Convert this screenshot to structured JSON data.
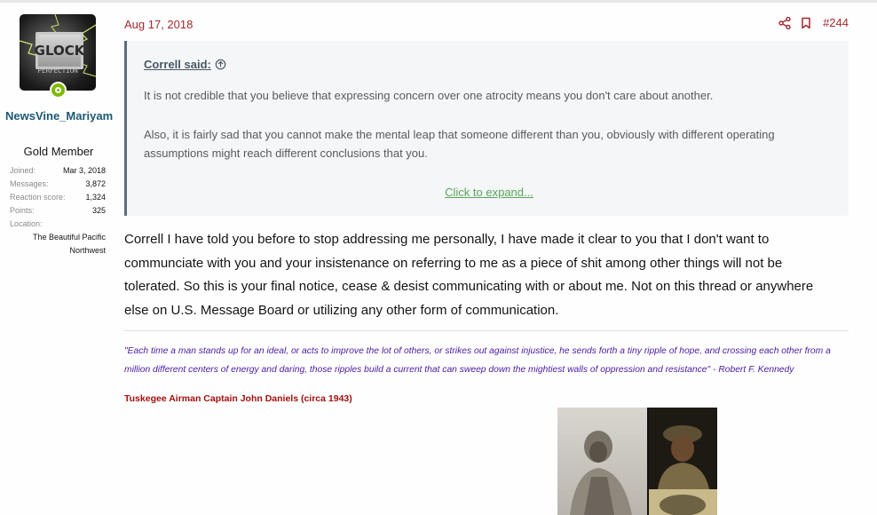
{
  "user": {
    "avatar_text": "GLOCK",
    "avatar_subtext": "PERFECTION",
    "name": "NewsVine_Mariyam",
    "title": "Gold Member",
    "stats": [
      {
        "label": "Joined:",
        "value": "Mar 3, 2018"
      },
      {
        "label": "Messages:",
        "value": "3,872"
      },
      {
        "label": "Reaction score:",
        "value": "1,324"
      },
      {
        "label": "Points:",
        "value": "325"
      },
      {
        "label": "Location:",
        "value": ""
      }
    ],
    "location": "The Beautiful Pacific Northwest",
    "online_color": "#7fb900"
  },
  "post": {
    "date": "Aug 17, 2018",
    "number": "#244",
    "icons": [
      "share-icon",
      "bookmark-icon"
    ],
    "accent_color": "#a4282d"
  },
  "quote": {
    "author": "Correll said:",
    "paragraphs": [
      "It is not credible that you believe that expressing concern over one atrocity means you don't care about another.",
      "Also, it is fairly sad that you cannot make the mental leap that someone different than you, obviously with different operating assumptions might reach different conclusions that you."
    ],
    "expand_label": "Click to expand..."
  },
  "message": "Correll I have told you before to stop addressing me personally, I have made it clear to you that I don't want to communciate with you and your insistenance on referring to me as a piece of shit among other things will not be tolerated. So this is your final notice, cease & desist communicating with or about me. Not on this thread or anywhere else on U.S. Message Board or utilizing any other form of communication.",
  "signature": {
    "quote": "\"Each time a man stands up for an ideal, or acts to improve the lot of others, or strikes out against injustice, he sends forth a tiny ripple of hope, and crossing each other from a million different centers of energy and daring, those ripples build a current that can sweep down the mightiest walls of oppression and resistance\" - Robert F. Kennedy",
    "image_title": "Tuskegee Airman Captain John Daniels (circa 1943)"
  }
}
